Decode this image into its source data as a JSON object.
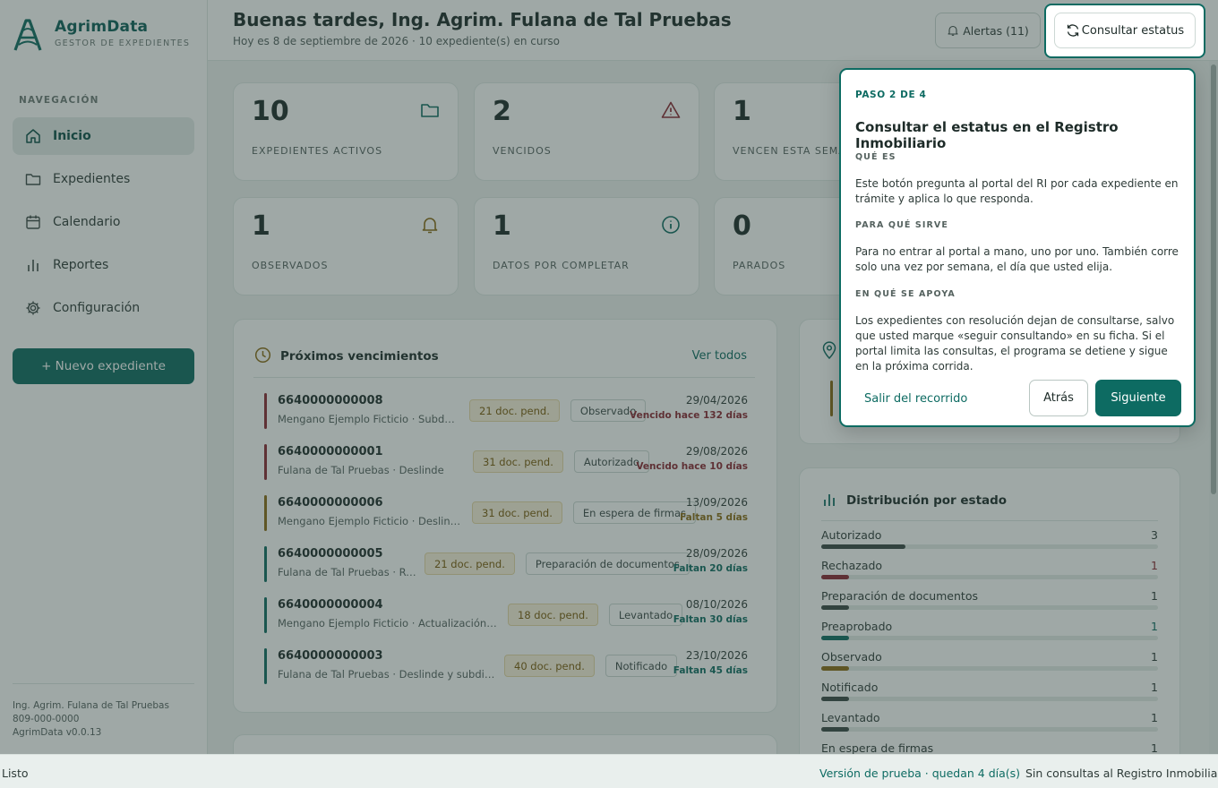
{
  "brand": {
    "name": "AgrimData",
    "subtitle": "GESTOR DE EXPEDIENTES"
  },
  "sidebar": {
    "heading": "NAVEGACIÓN",
    "items": [
      {
        "label": "Inicio",
        "icon": "home-icon"
      },
      {
        "label": "Expedientes",
        "icon": "folder-icon"
      },
      {
        "label": "Calendario",
        "icon": "calendar-icon"
      },
      {
        "label": "Reportes",
        "icon": "bar-chart-icon"
      },
      {
        "label": "Configuración",
        "icon": "gear-icon"
      }
    ],
    "new_button": "+ Nuevo expediente",
    "footer": {
      "user": "Ing. Agrim. Fulana de Tal Pruebas",
      "phone": "809-000-0000",
      "version": "AgrimData v0.0.13"
    }
  },
  "header": {
    "greeting": "Buenas tardes, Ing. Agrim. Fulana de Tal Pruebas",
    "subtitle": "Hoy es 8 de septiembre de 2026 · 10 expediente(s) en curso",
    "alerts_label": "Alertas (11)",
    "status_label": "Consultar estatus"
  },
  "stats": [
    {
      "value": "10",
      "label": "EXPEDIENTES ACTIVOS",
      "icon": "folder-icon"
    },
    {
      "value": "2",
      "label": "VENCIDOS",
      "icon": "warning-icon"
    },
    {
      "value": "1",
      "label": "VENCEN ESTA SEMANA",
      "icon": ""
    },
    {
      "value": "1",
      "label": "OBSERVADOS",
      "icon": "bell-icon"
    },
    {
      "value": "1",
      "label": "DATOS POR COMPLETAR",
      "icon": "info-icon"
    },
    {
      "value": "0",
      "label": "PARADOS",
      "icon": ""
    }
  ],
  "upcoming": {
    "title": "Próximos vencimientos",
    "view_all": "Ver todos",
    "rows": [
      {
        "id": "6640000000008",
        "sub": "Mengano Ejemplo Ficticio · Subdivi...",
        "docs": "21 doc. pend.",
        "state": "Observado",
        "date": "29/04/2026",
        "note": "Vencido hace 132 días",
        "tone": "overdue"
      },
      {
        "id": "6640000000001",
        "sub": "Fulana de Tal Pruebas · Deslinde",
        "docs": "31 doc. pend.",
        "state": "Autorizado",
        "date": "29/08/2026",
        "note": "Vencido hace 10 días",
        "tone": "overdue"
      },
      {
        "id": "6640000000006",
        "sub": "Mengano Ejemplo Ficticio · Deslinde",
        "docs": "31 doc. pend.",
        "state": "En espera de firmas",
        "date": "13/09/2026",
        "note": "Faltan 5 días",
        "tone": "soon"
      },
      {
        "id": "6640000000005",
        "sub": "Fulana de Tal Pruebas · Ref...",
        "docs": "21 doc. pend.",
        "state": "Preparación de documentos",
        "date": "28/09/2026",
        "note": "Faltan 20 días",
        "tone": "ok"
      },
      {
        "id": "6640000000004",
        "sub": "Mengano Ejemplo Ficticio · Actualización de...",
        "docs": "18 doc. pend.",
        "state": "Levantado",
        "date": "08/10/2026",
        "note": "Faltan 30 días",
        "tone": "ok"
      },
      {
        "id": "6640000000003",
        "sub": "Fulana de Tal Pruebas · Deslinde y subdivisión",
        "docs": "40 doc. pend.",
        "state": "Notificado",
        "date": "23/10/2026",
        "note": "Faltan 45 días",
        "tone": "ok"
      }
    ]
  },
  "distribution": {
    "title": "Distribución por estado",
    "max": 3,
    "rows": [
      {
        "label": "Autorizado",
        "count": 3,
        "color": "#3a4744"
      },
      {
        "label": "Rechazado",
        "count": 1,
        "color": "#8a2732"
      },
      {
        "label": "Preparación de documentos",
        "count": 1,
        "color": "#3a4744"
      },
      {
        "label": "Preaprobado",
        "count": 1,
        "color": "#0d6b62"
      },
      {
        "label": "Observado",
        "count": 1,
        "color": "#8a6a14"
      },
      {
        "label": "Notificado",
        "count": 1,
        "color": "#3a4744"
      },
      {
        "label": "Levantado",
        "count": 1,
        "color": "#3a4744"
      },
      {
        "label": "En espera de firmas",
        "count": 1,
        "color": "#3a4744"
      }
    ]
  },
  "tour": {
    "step": "PASO 2 DE 4",
    "title": "Consultar el estatus en el Registro Inmobiliario",
    "que_es_h": "QUÉ ES",
    "que_es": "Este botón pregunta al portal del RI por cada expediente en trámite y aplica lo que responda.",
    "para_que_h": "PARA QUÉ SIRVE",
    "para_que": "Para no entrar al portal a mano, uno por uno. También corre solo una vez por semana, el día que usted elija.",
    "apoya_h": "EN QUÉ SE APOYA",
    "apoya": "Los expedientes con resolución dejan de consultarse, salvo que usted marque «seguir consultando» en su ficha. Si el portal limita las consultas, el programa se detiene y sigue en la próxima corrida.",
    "exit_label": "Salir del recorrido",
    "back_label": "Atrás",
    "next_label": "Siguiente"
  },
  "statusbar": {
    "left": "Listo",
    "trial": "Versión de prueba · quedan 4 día(s)",
    "ri": "Sin consultas al Registro Inmobiliario"
  },
  "colors": {
    "accent": "#0d6b62",
    "overdue": "#8a2732",
    "soon": "#8a6a14",
    "ok": "#0d6b62"
  }
}
